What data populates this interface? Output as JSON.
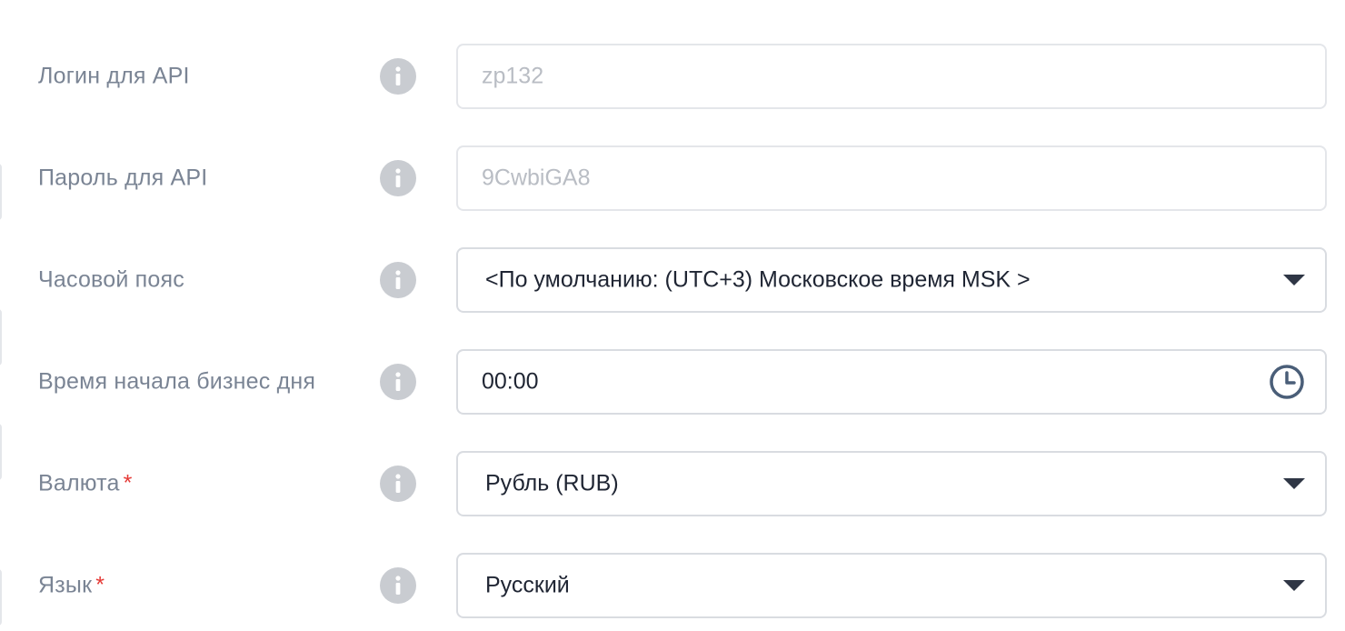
{
  "fields": [
    {
      "label": "Логин для API",
      "required": false,
      "type": "text",
      "placeholder": "zp132",
      "value": ""
    },
    {
      "label": "Пароль для API",
      "required": false,
      "type": "text",
      "placeholder": "9CwbiGA8",
      "value": ""
    },
    {
      "label": "Часовой пояс",
      "required": false,
      "type": "select",
      "value": "<По умолчанию: (UTC+3) Московское время MSK >"
    },
    {
      "label": "Время начала бизнес дня",
      "required": false,
      "type": "time",
      "value": "00:00"
    },
    {
      "label": "Валюта",
      "required": true,
      "type": "select",
      "value": "Рубль (RUB)"
    },
    {
      "label": "Язык",
      "required": true,
      "type": "select",
      "value": "Русский"
    }
  ],
  "required_mark": "*",
  "icons": {
    "info": "info-icon",
    "caret": "chevron-down-icon",
    "clock": "clock-icon"
  },
  "colors": {
    "label": "#7a8494",
    "required": "#e53935",
    "placeholder": "#b9bdc4",
    "value": "#1f2533",
    "border": "#e4e6ea",
    "info_bg": "#c9ccd1",
    "clock": "#4a5e78"
  }
}
